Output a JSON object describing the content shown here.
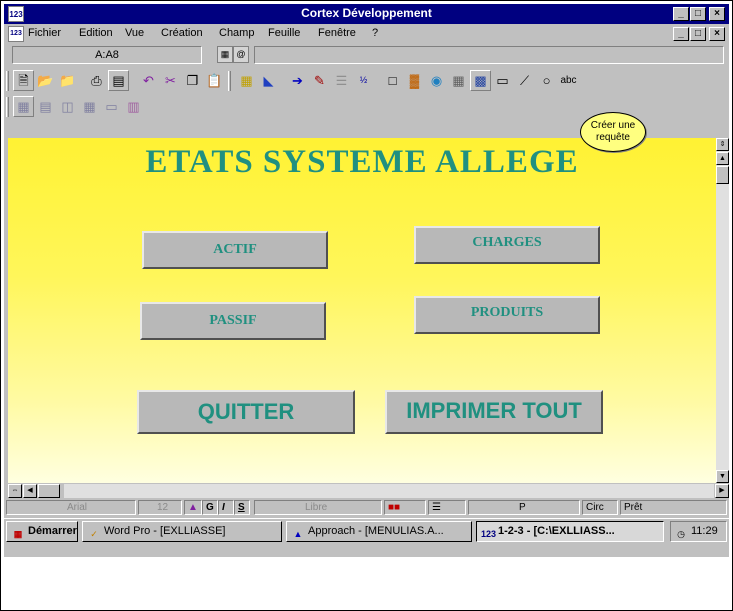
{
  "window": {
    "app_icon": "123",
    "title": "Cortex Développement",
    "controls": [
      "_",
      "□",
      "×"
    ]
  },
  "menu": {
    "doc_icon": "123",
    "items": [
      "Fichier",
      "Edition",
      "Vue",
      "Création",
      "Champ",
      "Feuille",
      "Fenêtre",
      "?"
    ],
    "doc_controls": [
      "_",
      "□",
      "×"
    ]
  },
  "cell_reference": "A:A8",
  "tooltip": {
    "line1": "Créer une",
    "line2": "requête"
  },
  "sheet": {
    "title": "ETATS SYSTEME ALLEGE",
    "buttons": {
      "actif": "ACTIF",
      "charges": "CHARGES",
      "passif": "PASSIF",
      "produits": "PRODUITS",
      "quitter": "QUITTER",
      "imprimer": "IMPRIMER TOUT"
    }
  },
  "status": {
    "font": "Arial",
    "size": "12",
    "bold": "G",
    "italic": "I",
    "underline": "S",
    "style": "Libre",
    "cell_format": "P",
    "mode": "Circ",
    "state": "Prêt"
  },
  "taskbar": {
    "start": "Démarrer",
    "tasks": [
      "Word Pro - [EXLLIASSE]",
      "Approach - [MENULIAS.A...",
      "1-2-3 - [C:\\EXLLIASS..."
    ],
    "clock": "11:29"
  },
  "colors": {
    "title_bar": "#000080",
    "sheet_text": "#209080",
    "sheet_background": "#fff233",
    "tooltip": "#ffff80"
  },
  "icons": [
    "new-sheet-icon",
    "open-file-icon",
    "save-icon",
    "print-icon",
    "print-preview-icon",
    "undo-icon",
    "cut-icon",
    "copy-icon",
    "paste-icon",
    "create-query-icon",
    "draw-line-icon",
    "draw-ellipse-icon",
    "text-block-icon"
  ]
}
